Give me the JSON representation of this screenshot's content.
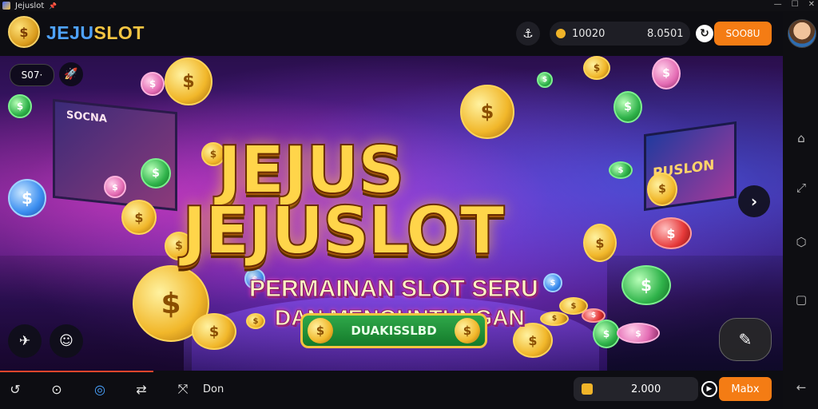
{
  "window": {
    "title": "Jejuslot",
    "pin": "📌",
    "controls": [
      "—",
      "☐",
      "✕"
    ]
  },
  "header": {
    "logo_coin_symbol": "$",
    "logo_part1": "JEJU",
    "logo_part2": "SLOT",
    "user_icon": "⚓",
    "balance_primary": "10020",
    "balance_secondary": "8.0501",
    "refresh_icon": "↻",
    "deposit_label": "SOO8U"
  },
  "banner": {
    "chip_label": "S07·",
    "rocket_icon": "🚀",
    "hero_line1": "JEJUS",
    "hero_line2": "JEJUSLOT",
    "subtitle_line1": "PERMAINAN SLOT SERU",
    "subtitle_line2": "DAN MENGUNTUNGAN",
    "cta_label": "DUAKISSLBD",
    "screen_left_label": "SOCNA",
    "screen_right_label": "PUSLON",
    "next_icon": "›",
    "coin_symbol": "$",
    "left_badge_icon": "$"
  },
  "bottom": {
    "nav_icons": [
      "↺",
      "⊙",
      "◎",
      "⇄",
      "⤧"
    ],
    "label": "Don",
    "balance": "2.000",
    "action_label": "Mabx",
    "play_icon": "▶",
    "tool_left_icon": "✈",
    "tool_right_icon": "☺",
    "fab_icon": "✎"
  },
  "sidenav": {
    "icons": [
      "⌂",
      "⤢",
      "⬡",
      "▢",
      "←"
    ]
  },
  "colors": {
    "accent": "#f47c14",
    "brand_blue": "#4fa3ff",
    "brand_gold": "#f5c542",
    "progress": "#e8452b"
  }
}
